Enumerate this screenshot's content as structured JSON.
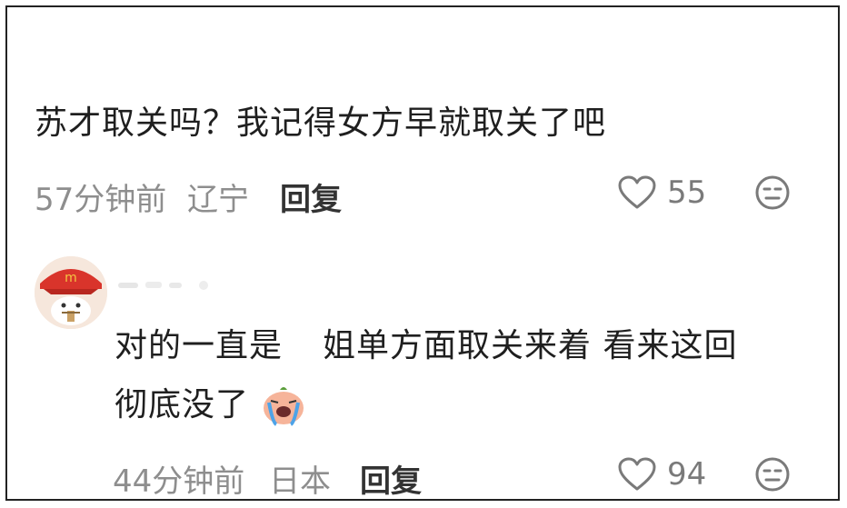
{
  "comments": [
    {
      "text": "苏才取关吗？我记得女方早就取关了吧",
      "time": "57分钟前",
      "location": "辽宁",
      "reply_label": "回复",
      "like_count": "55"
    },
    {
      "text_line1_a": "对的一直是",
      "text_line1_b": "姐单方面取关来着 看来这回",
      "text_line2": "彻底没了",
      "time": "44分钟前",
      "location": "日本",
      "reply_label": "回复",
      "like_count": "94"
    }
  ],
  "icons": {
    "like": "heart-outline-icon",
    "react": "neutral-face-icon",
    "sticker": "crying-sticker-icon"
  },
  "colors": {
    "text": "#1f1f1f",
    "meta": "#8e8e8e",
    "avatar_red": "#d9342b"
  }
}
